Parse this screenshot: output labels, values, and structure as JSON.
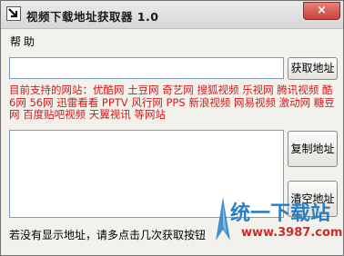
{
  "window": {
    "title": "视频下载地址获取器 1.0",
    "close_label": "×"
  },
  "menu": {
    "help_label": "帮助"
  },
  "url_input": {
    "value": "",
    "placeholder": ""
  },
  "buttons": {
    "get_label": "获取地址",
    "copy_label": "复制地址",
    "clear_label": "清空地址"
  },
  "supported_sites_text": "目前支持的网站：优酷网 土豆网 奇艺网 搜狐视频 乐视网 腾讯视频 酷6网 56网 迅雷看看 PPTV 风行网 PPS 新浪视频 网易视频 激动网 糖豆网 百度贴吧视频 天翼视讯 等网站",
  "result_box": {
    "value": ""
  },
  "hint_text": "若没有显示地址，请多点击几次获取按钮",
  "watermark": {
    "name": "统一下载站",
    "url": "www.3987.com"
  },
  "colors": {
    "supported_text": "#d11a1a",
    "watermark_blue": "#2a7ec2",
    "watermark_red": "#d12a2a"
  },
  "icons": {
    "app": "arrow-down-right-icon",
    "close": "close-icon"
  }
}
